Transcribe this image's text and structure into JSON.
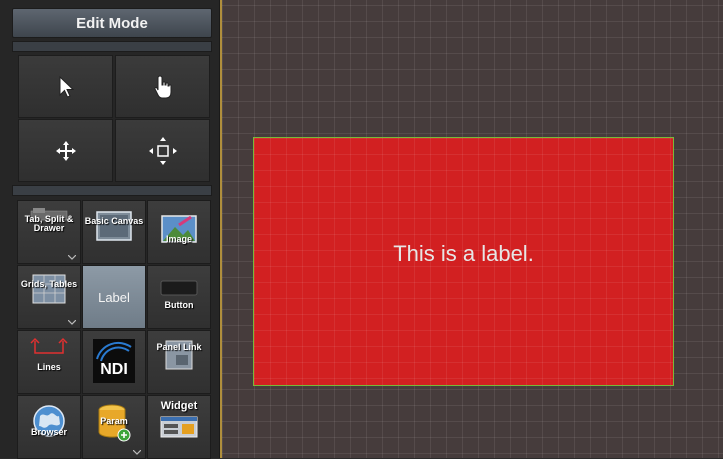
{
  "panel": {
    "title": "Edit Mode",
    "tools": [
      {
        "name": "pointer",
        "icon": "arrow-pointer-icon"
      },
      {
        "name": "hand",
        "icon": "hand-pointer-icon"
      },
      {
        "name": "move",
        "icon": "move-arrows-icon"
      },
      {
        "name": "resize",
        "icon": "resize-box-icon"
      }
    ],
    "widgets": {
      "tab_split_drawer": "Tab, Split & Drawer",
      "basic_canvas": "Basic Canvas",
      "image": "Image",
      "grids_tables": "Grids, Tables",
      "label": "Label",
      "button": "Button",
      "lines": "Lines",
      "ndi": "NDI",
      "panel_link": "Panel Link",
      "browser": "Browser",
      "param": "Param",
      "widget": "Widget"
    }
  },
  "canvas": {
    "label_text": "This is a label.",
    "label_bg": "#d22021",
    "selection_color": "#79b839",
    "grid_bg": "#463c3c"
  }
}
